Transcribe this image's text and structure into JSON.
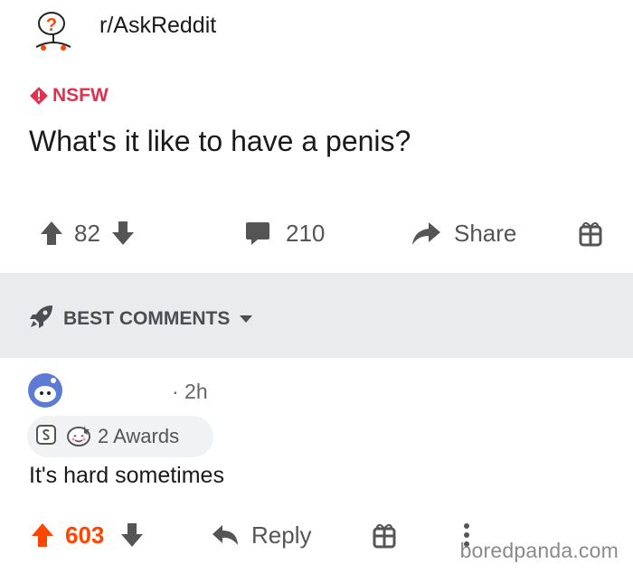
{
  "post": {
    "subreddit": "r/AskReddit",
    "nsfw_label": "NSFW",
    "title": "What's it like to have a penis?",
    "upvotes": "82",
    "comments": "210",
    "share_label": "Share"
  },
  "sort": {
    "label": "BEST COMMENTS"
  },
  "comment": {
    "age": "· 2h",
    "awards_label": "2 Awards",
    "text": "It's hard sometimes",
    "upvotes": "603",
    "reply_label": "Reply"
  },
  "watermark": "boredpanda.com",
  "colors": {
    "nsfw": "#e0324f",
    "upvote_active": "#ff4500",
    "icon_grey": "#555555",
    "sort_bar_bg": "#e9ebed"
  }
}
